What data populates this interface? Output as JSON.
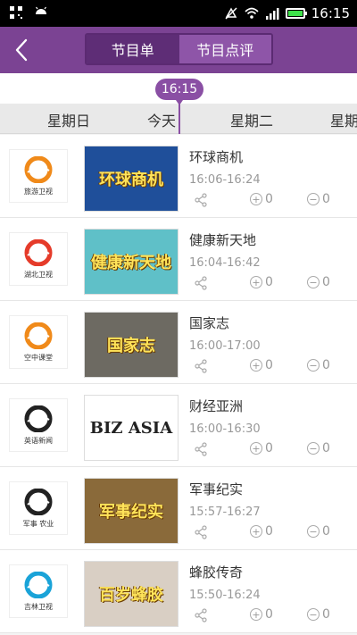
{
  "status_bar": {
    "time": "16:15",
    "battery_level": 0.9
  },
  "header": {
    "tabs": [
      {
        "label": "节目单",
        "active": true
      },
      {
        "label": "节目点评",
        "active": false
      }
    ]
  },
  "timeline": {
    "current_time": "16:15"
  },
  "days": [
    "星期日",
    "今天",
    "星期二",
    "星期"
  ],
  "programs": [
    {
      "channel": "旅游卫视",
      "title": "环球商机",
      "time": "16:06-16:24",
      "likes": "0",
      "dislikes": "0",
      "thumb_text": "环球商机",
      "logo_color": "#f08a1a",
      "thumb_bg": "#1f4f9a"
    },
    {
      "channel": "湖北卫视",
      "title": "健康新天地",
      "time": "16:04-16:42",
      "likes": "0",
      "dislikes": "0",
      "thumb_text": "健康新天地",
      "logo_color": "#e53b2a",
      "thumb_bg": "#5fc0c8"
    },
    {
      "channel": "空中课堂",
      "title": "国家志",
      "time": "16:00-17:00",
      "likes": "0",
      "dislikes": "0",
      "thumb_text": "国家志",
      "logo_color": "#f08a1a",
      "thumb_bg": "#6d6a62"
    },
    {
      "channel": "英语新闻",
      "title": "财经亚洲",
      "time": "16:00-16:30",
      "likes": "0",
      "dislikes": "0",
      "thumb_text": "BIZ ASIA",
      "logo_color": "#222222",
      "thumb_bg": "#ffffff"
    },
    {
      "channel": "军事 农业",
      "title": "军事纪实",
      "time": "15:57-16:27",
      "likes": "0",
      "dislikes": "0",
      "thumb_text": "军事纪实",
      "logo_color": "#222222",
      "thumb_bg": "#8a6a3a"
    },
    {
      "channel": "吉林卫视",
      "title": "蜂胶传奇",
      "time": "15:50-16:24",
      "likes": "0",
      "dislikes": "0",
      "thumb_text": "百岁蜂胶",
      "logo_color": "#1aa3d8",
      "thumb_bg": "#d9cfc4"
    }
  ],
  "colors": {
    "accent": "#7b4393",
    "tab_active": "#5e2d76"
  }
}
